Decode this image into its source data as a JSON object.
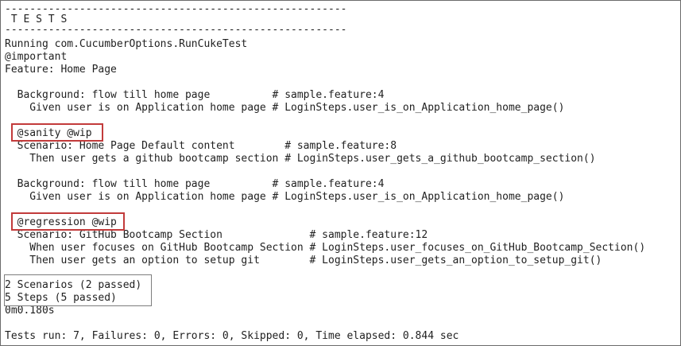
{
  "console": {
    "lines": [
      "-------------------------------------------------------",
      " T E S T S",
      "-------------------------------------------------------",
      "Running com.CucumberOptions.RunCukeTest",
      "@important",
      "Feature: Home Page",
      "",
      "  Background: flow till home page          # sample.feature:4",
      "    Given user is on Application home page # LoginSteps.user_is_on_Application_home_page()",
      "",
      "  @sanity @wip",
      "  Scenario: Home Page Default content        # sample.feature:8",
      "    Then user gets a github bootcamp section # LoginSteps.user_gets_a_github_bootcamp_section()",
      "",
      "  Background: flow till home page          # sample.feature:4",
      "    Given user is on Application home page # LoginSteps.user_is_on_Application_home_page()",
      "",
      "  @regression @wip",
      "  Scenario: GitHub Bootcamp Section              # sample.feature:12",
      "    When user focuses on GitHub Bootcamp Section # LoginSteps.user_focuses_on_GitHub_Bootcamp_Section()",
      "    Then user gets an option to setup git        # LoginSteps.user_gets_an_option_to_setup_git()",
      "",
      "2 Scenarios (2 passed)",
      "5 Steps (5 passed)",
      "0m0.180s",
      "",
      "Tests run: 7, Failures: 0, Errors: 0, Skipped: 0, Time elapsed: 0.844 sec"
    ]
  },
  "colors": {
    "text": "#1f1f1f",
    "highlight_border": "#c23b3b",
    "summary_border": "#7d7d7d"
  }
}
